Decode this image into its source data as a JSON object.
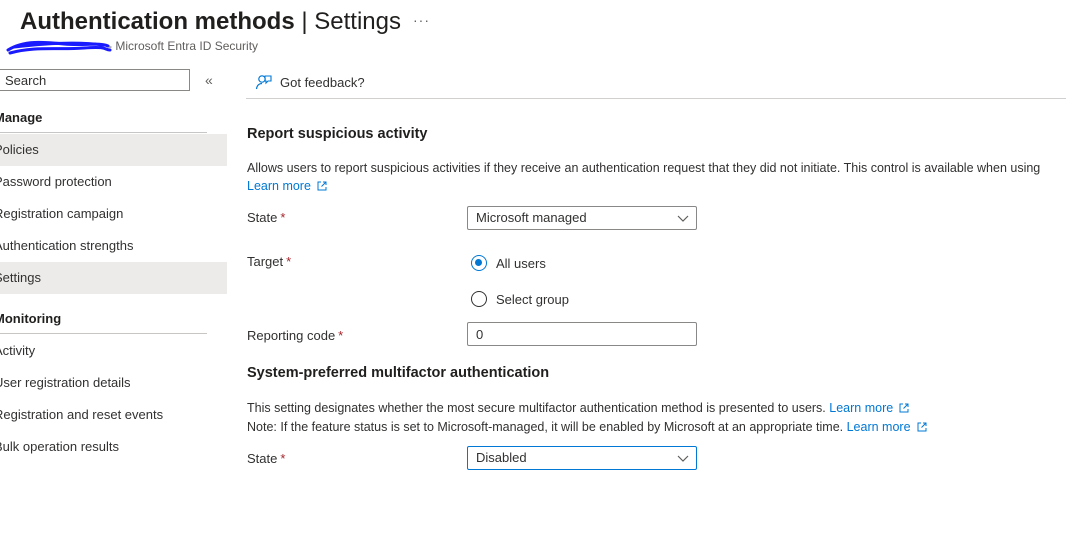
{
  "header": {
    "title": "Authentication methods",
    "separator": "|",
    "subtitle_page": "Settings",
    "more": "···",
    "breadcrumb": "- Microsoft Entra ID Security"
  },
  "sidebar": {
    "search": {
      "value": "",
      "placeholder": "Search"
    },
    "collapse": "«",
    "groups": [
      {
        "header": "Manage",
        "items": [
          {
            "label": "Policies",
            "selected": true
          },
          {
            "label": "Password protection",
            "selected": false
          },
          {
            "label": "Registration campaign",
            "selected": false
          },
          {
            "label": "Authentication strengths",
            "selected": false
          },
          {
            "label": "Settings",
            "selected": true
          }
        ]
      },
      {
        "header": "Monitoring",
        "items": [
          {
            "label": "Activity",
            "selected": false
          },
          {
            "label": "User registration details",
            "selected": false
          },
          {
            "label": "Registration and reset events",
            "selected": false
          },
          {
            "label": "Bulk operation results",
            "selected": false
          }
        ]
      }
    ]
  },
  "toolbar": {
    "feedback_label": "Got feedback?"
  },
  "report_suspicious": {
    "title": "Report suspicious activity",
    "description": "Allows users to report suspicious activities if they receive an authentication request that they did not initiate. This control is available when using",
    "learn_more": "Learn more",
    "state_label": "State",
    "state_value": "Microsoft managed",
    "target_label": "Target",
    "target_options": [
      "All users",
      "Select group"
    ],
    "target_selected": "All users",
    "reporting_code_label": "Reporting code",
    "reporting_code_value": "0"
  },
  "system_preferred": {
    "title": "System-preferred multifactor authentication",
    "line1": "This setting designates whether the most secure multifactor authentication method is presented to users.",
    "line1_link": "Learn more",
    "line2": "Note: If the feature status is set to Microsoft-managed, it will be enabled by Microsoft at an appropriate time.",
    "line2_link": "Learn more",
    "state_label": "State",
    "state_value": "Disabled"
  },
  "required_marker": "*",
  "colors": {
    "link": "#0078d4",
    "selected_nav": "#edebe9",
    "required": "#a4262c",
    "scribble": "#1a1aff"
  }
}
